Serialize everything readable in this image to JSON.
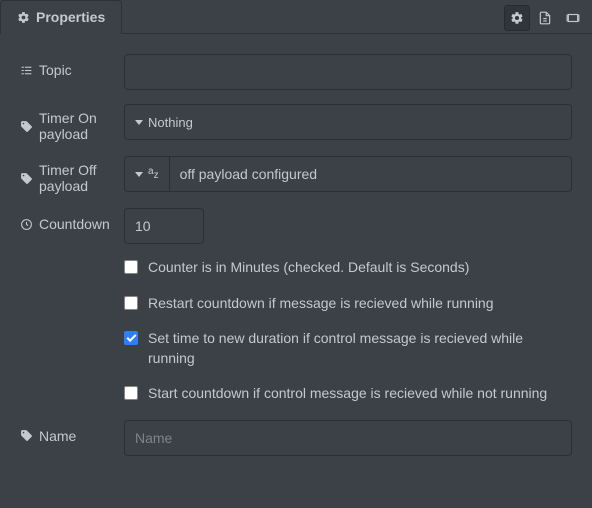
{
  "tab": {
    "title": "Properties"
  },
  "labels": {
    "topic": "Topic",
    "timerOn": "Timer On payload",
    "timerOff": "Timer Off payload",
    "countdown": "Countdown",
    "name": "Name"
  },
  "fields": {
    "topic": "",
    "timerOnType": "Nothing",
    "timerOffValue": "off payload configured",
    "countdown": "10",
    "namePlaceholder": "Name"
  },
  "checkboxes": {
    "minutes": {
      "label": "Counter is in Minutes (checked. Default is Seconds)",
      "checked": false
    },
    "restart": {
      "label": "Restart countdown if message is recieved while running",
      "checked": false
    },
    "setNew": {
      "label": "Set time to new duration if control message is recieved while running",
      "checked": true
    },
    "startOnCtrl": {
      "label": "Start countdown if control message is recieved while not running",
      "checked": false
    }
  }
}
